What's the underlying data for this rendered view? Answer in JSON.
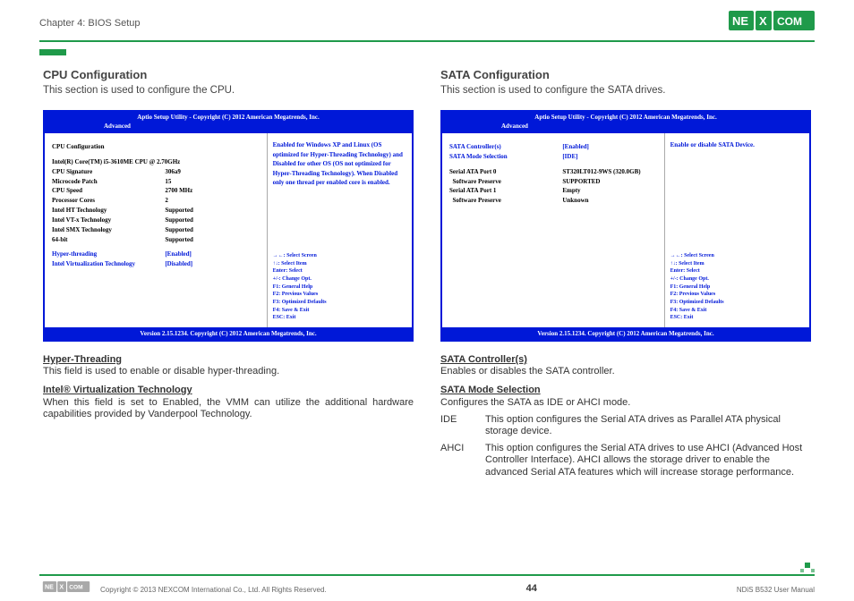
{
  "header": {
    "chapter": "Chapter 4: BIOS Setup",
    "brand": "NEXCOM"
  },
  "left": {
    "title": "CPU Configuration",
    "subtitle": "This section is used to configure the CPU.",
    "bios": {
      "top": "Aptio Setup Utility - Copyright (C) 2012 American Megatrends, Inc.",
      "tab": "Advanced",
      "heading": "CPU Configuration",
      "cpu_line": "Intel(R) Core(TM) i5-3610ME CPU @ 2.70GHz",
      "rows": [
        {
          "k": "CPU Signature",
          "v": "306a9"
        },
        {
          "k": "Microcode Patch",
          "v": "15"
        },
        {
          "k": "CPU Speed",
          "v": "2700 MHz"
        },
        {
          "k": "Processor Cores",
          "v": "2"
        },
        {
          "k": "Intel HT Technology",
          "v": "Supported"
        },
        {
          "k": "Intel VT-x Technology",
          "v": "Supported"
        },
        {
          "k": "Intel SMX Technology",
          "v": "Supported"
        },
        {
          "k": "64-bit",
          "v": "Supported"
        }
      ],
      "opt1_k": "Hyper-threading",
      "opt1_v": "[Enabled]",
      "opt2_k": "Intel Virtualization Technology",
      "opt2_v": "[Disabled]",
      "help": "Enabled for Windows XP and Linux (OS optimized for Hyper-Threading Technology) and Disabled for other OS (OS not optimized for Hyper-Threading Technology). When Disabled only one thread per enabled core is enabled.",
      "keys": {
        "a": "→←: Select Screen",
        "b": "↑↓: Select Item",
        "c": "Enter: Select",
        "d": "+/-: Change Opt.",
        "e": "F1: General Help",
        "f": "F2: Previous Values",
        "g": "F3: Optimized Defaults",
        "h": "F4: Save & Exit",
        "i": "ESC: Exit"
      },
      "ver": "Version 2.15.1234. Copyright (C) 2012 American Megatrends, Inc."
    },
    "explain": {
      "h1": "Hyper-Threading",
      "p1": "This field is used to enable or disable hyper-threading.",
      "h2": "Intel® Virtualization Technology",
      "p2": "When this field is set to Enabled, the VMM can utilize the additional hardware capabilities provided by Vanderpool Technology."
    }
  },
  "right": {
    "title": "SATA Configuration",
    "subtitle": "This section is used to configure the SATA drives.",
    "bios": {
      "top": "Aptio Setup Utility - Copyright (C) 2012 American Megatrends, Inc.",
      "tab": "Advanced",
      "r1k": "SATA Controller(s)",
      "r1v": "[Enabled]",
      "r2k": "SATA Mode Selection",
      "r2v": "[IDE]",
      "r3k": "Serial ATA Port 0",
      "r3v": "ST320LT012-9WS (320.0GB)",
      "r4k": "  Software Preserve",
      "r4v": "SUPPORTED",
      "r5k": "Serial ATA Port 1",
      "r5v": "Empty",
      "r6k": "  Software Preserve",
      "r6v": "Unknown",
      "help": "Enable or disable SATA Device.",
      "keys": {
        "a": "→←: Select Screen",
        "b": "↑↓: Select Item",
        "c": "Enter: Select",
        "d": "+/-: Change Opt.",
        "e": "F1: General Help",
        "f": "F2: Previous Values",
        "g": "F3: Optimized Defaults",
        "h": "F4: Save & Exit",
        "i": "ESC: Exit"
      },
      "ver": "Version 2.15.1234. Copyright (C) 2012 American Megatrends, Inc."
    },
    "explain": {
      "h1": "SATA Controller(s)",
      "p1": "Enables or disables the SATA controller.",
      "h2": "SATA Mode Selection",
      "p2": "Configures the SATA as IDE or AHCI mode.",
      "ide_label": "IDE",
      "ide_text": "This option configures the Serial ATA drives as Parallel ATA physical storage device.",
      "ahci_label": "AHCI",
      "ahci_text": "This option configures the Serial ATA drives to use AHCI (Advanced Host Controller Interface). AHCI allows the storage driver to enable the advanced Serial ATA features which will increase storage performance."
    }
  },
  "footer": {
    "copyright": "Copyright © 2013 NEXCOM International Co., Ltd. All Rights Reserved.",
    "page": "44",
    "manual": "NDiS B532 User Manual"
  }
}
